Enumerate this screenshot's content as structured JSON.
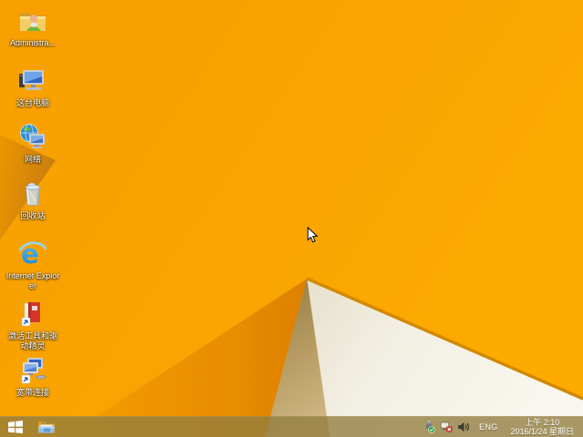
{
  "desktop": {
    "icons": [
      {
        "label": "Administra...",
        "icon": "user-folder"
      },
      {
        "label": "这台电脑",
        "icon": "this-pc"
      },
      {
        "label": "网络",
        "icon": "network"
      },
      {
        "label": "回收站",
        "icon": "recycle-bin"
      },
      {
        "label": "Internet Explorer",
        "icon": "internet-explorer"
      },
      {
        "label": "激活工具和驱动精灵",
        "icon": "activation-tools"
      },
      {
        "label": "宽带连接",
        "icon": "broadband-connection"
      }
    ]
  },
  "taskbar": {
    "tray": {
      "language": "ENG",
      "time": "上午 2:10",
      "date": "2016/1/24 星期日",
      "icons": [
        "safely-remove-hardware",
        "network-disconnected",
        "volume"
      ]
    }
  },
  "colors": {
    "wallpaper_orange": "#F9A201",
    "wallpaper_orange_dark": "#E08300",
    "wallpaper_wedge": "#D8880C",
    "wallpaper_khaki": "#BFA36E",
    "wallpaper_cream": "#F2EEE1",
    "facet_line": "#D08800",
    "taskbar_tint": "#927C3E",
    "label_text": "#FFFFFF",
    "check_badge": "#2FA33C",
    "error_badge": "#C5352C"
  }
}
